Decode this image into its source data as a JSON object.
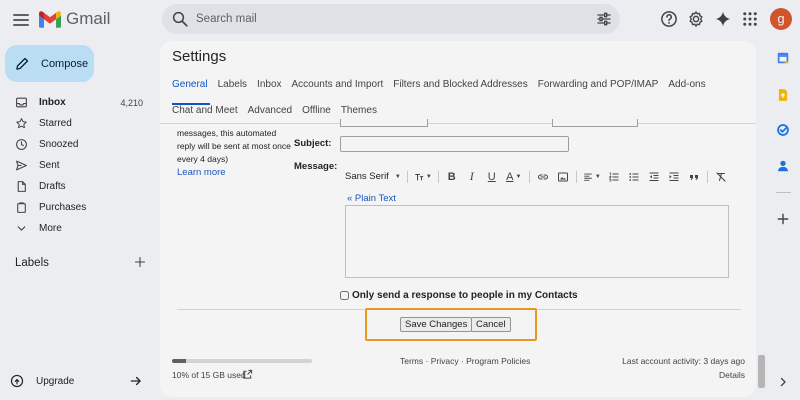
{
  "app": {
    "name": "Gmail",
    "avatar_letter": "g",
    "avatar_color": "#d9572c"
  },
  "search": {
    "placeholder": "Search mail"
  },
  "sidebar": {
    "compose_label": "Compose",
    "items": [
      {
        "label": "Inbox",
        "count": "4,210",
        "icon": "inbox-icon"
      },
      {
        "label": "Starred",
        "icon": "star-icon"
      },
      {
        "label": "Snoozed",
        "icon": "clock-icon"
      },
      {
        "label": "Sent",
        "icon": "send-icon"
      },
      {
        "label": "Drafts",
        "icon": "draft-icon"
      },
      {
        "label": "Purchases",
        "icon": "purchases-icon"
      },
      {
        "label": "More",
        "icon": "chevron-down-icon"
      }
    ],
    "labels_heading": "Labels",
    "upgrade_label": "Upgrade"
  },
  "settings": {
    "title": "Settings",
    "tabs_row1": [
      "General",
      "Labels",
      "Inbox",
      "Accounts and Import",
      "Filters and Blocked Addresses",
      "Forwarding and POP/IMAP",
      "Add-ons"
    ],
    "tabs_row2": [
      "Chat and Meet",
      "Advanced",
      "Offline",
      "Themes"
    ],
    "active_tab": "General",
    "auto_reply_note": [
      "messages, this automated",
      "reply will be sent at most once",
      "every 4 days)"
    ],
    "learn_more": "Learn more",
    "subject_label": "Subject:",
    "message_label": "Message:",
    "font_name": "Sans Serif",
    "plain_text_link": "« Plain Text",
    "contacts_checkbox_label": "Only send a response to people in my Contacts",
    "contacts_checked": false,
    "save_button": "Save Changes",
    "cancel_button": "Cancel",
    "highlight_color": "#f29f1d"
  },
  "footer": {
    "storage_text": "10% of 15 GB used",
    "storage_used_fraction": 0.1,
    "links": [
      "Terms",
      "Privacy",
      "Program Policies"
    ],
    "link_separator": " · ",
    "last_activity": "Last account activity: 3 days ago",
    "details": "Details"
  },
  "colors": {
    "accent": "#0b57d0",
    "compose_bg": "#c2e7ff",
    "link": "#1a57c9"
  }
}
